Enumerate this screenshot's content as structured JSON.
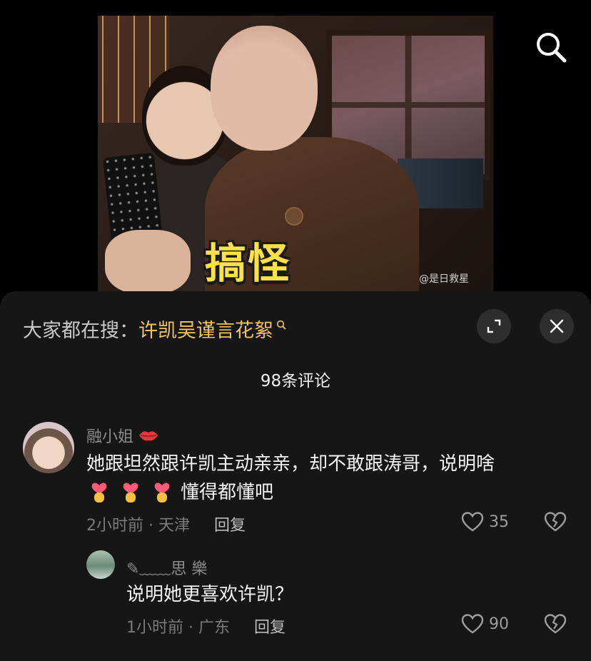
{
  "video": {
    "caption": "搞怪",
    "watermark": "@是日救星"
  },
  "search_button": {
    "icon": "search-icon"
  },
  "sheet": {
    "trending_prefix": "大家都在搜：",
    "trending_query": "许凯吴谨言花絮",
    "trending_icon": "search-small-icon",
    "expand_icon": "expand-icon",
    "close_icon": "close-icon",
    "comment_count": "98条评论"
  },
  "comments": [
    {
      "username": "融小姐",
      "username_emoji": "lips-icon",
      "text_line1": "她跟坦然跟许凯主动亲亲，却不敢跟涛哥，说明啥",
      "text_line2": "懂得都懂吧",
      "emojis": [
        "heart-hands-emoji",
        "heart-hands-emoji",
        "heart-hands-emoji"
      ],
      "time_location": "2小时前 · 天津",
      "reply_label": "回复",
      "likes": "35"
    },
    {
      "username": "✎﹏﹏思 樂",
      "text": "说明她更喜欢许凯？",
      "time_location": "1小时前 · 广东",
      "reply_label": "回复",
      "likes": "90"
    }
  ],
  "colors": {
    "background": "#000000",
    "sheet": "#161616",
    "trending_link": "#f3c45e",
    "caption": "#ffe24a"
  }
}
